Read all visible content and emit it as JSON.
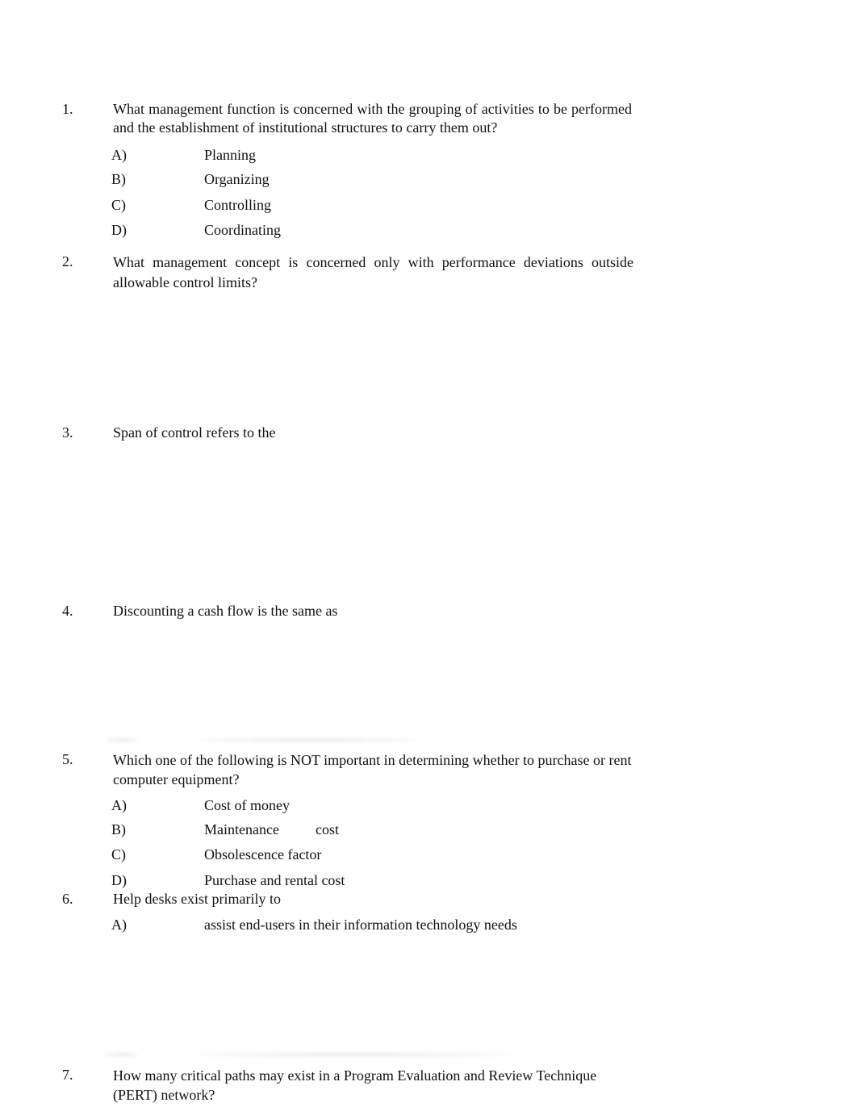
{
  "questions": [
    {
      "number": "1.",
      "text": "What management function is concerned with the grouping of activities to be performed and the establishment of institutional structures to carry them out?",
      "options": [
        {
          "letter": "A)",
          "text": "Planning"
        },
        {
          "letter": "B)",
          "text": "Organizing"
        },
        {
          "letter": "C)",
          "text": "Controlling"
        },
        {
          "letter": "D)",
          "text": "Coordinating"
        }
      ]
    },
    {
      "number": "2.",
      "text": "What management concept is concerned only with performance deviations outside allowable control limits?"
    },
    {
      "number": "3.",
      "text": "Span of control refers to the"
    },
    {
      "number": "4.",
      "text": "Discounting a cash flow is the same as"
    },
    {
      "number": "5.",
      "text": "Which one of the following is NOT important in determining whether to purchase or rent computer equipment?",
      "options": [
        {
          "letter": "A)",
          "text": "Cost of money"
        },
        {
          "letter": "B)",
          "text": "Maintenance          cost"
        },
        {
          "letter": "C)",
          "text": "Obsolescence factor"
        },
        {
          "letter": "D)",
          "text": "Purchase and rental cost"
        }
      ]
    },
    {
      "number": "6.",
      "text": "Help desks exist primarily to",
      "options": [
        {
          "letter": "A)",
          "text": "assist end-users in their information technology needs"
        }
      ]
    },
    {
      "number": "7.",
      "text": "How many critical paths may exist in a Program Evaluation and Review Technique (PERT) network?"
    }
  ]
}
